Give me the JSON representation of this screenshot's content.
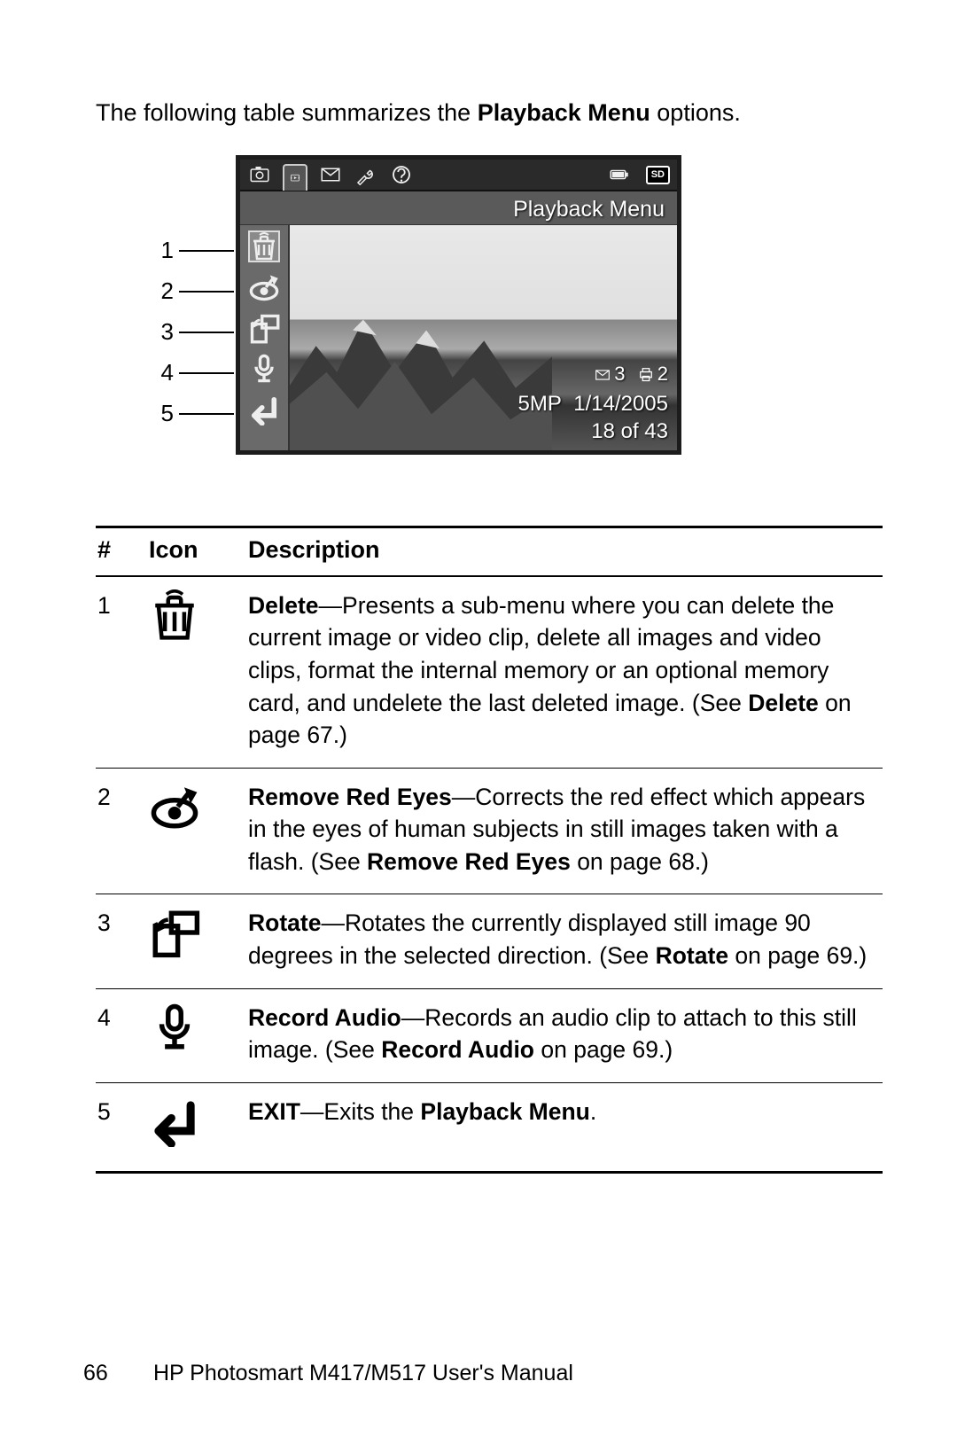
{
  "intro": {
    "before": "The following table summarizes the ",
    "bold": "Playback Menu",
    "after": " options."
  },
  "figure": {
    "lcd_title": "Playback Menu",
    "callouts": [
      "1",
      "2",
      "3",
      "4",
      "5"
    ],
    "overlay": {
      "mail_count": "3",
      "print_count": "2",
      "res": "5MP",
      "date": "1/14/2005",
      "counter": "18 of 43"
    },
    "sd_label": "SD"
  },
  "table": {
    "headers": {
      "num": "#",
      "icon": "Icon",
      "desc": "Description"
    },
    "rows": [
      {
        "num": "1",
        "icon": "trash",
        "parts": [
          {
            "b": "Delete"
          },
          {
            "t": "—Presents a sub-menu where you can delete the current image or video clip, delete all images and video clips, format the internal memory or an optional memory card, and undelete the last deleted image. (See "
          },
          {
            "b": "Delete"
          },
          {
            "t": " on page 67.)"
          }
        ]
      },
      {
        "num": "2",
        "icon": "redeye",
        "parts": [
          {
            "b": "Remove Red Eyes"
          },
          {
            "t": "—Corrects the red effect which appears in the eyes of human subjects in still images taken with a flash. (See "
          },
          {
            "b": "Remove Red Eyes"
          },
          {
            "t": " on page 68.)"
          }
        ]
      },
      {
        "num": "3",
        "icon": "rotate",
        "parts": [
          {
            "b": "Rotate"
          },
          {
            "t": "—Rotates the currently displayed still image 90 degrees in the selected direction. (See "
          },
          {
            "b": "Rotate"
          },
          {
            "t": " on page 69.)"
          }
        ]
      },
      {
        "num": "4",
        "icon": "mic",
        "parts": [
          {
            "b": "Record Audio"
          },
          {
            "t": "—Records an audio clip to attach to this still image. (See "
          },
          {
            "b": "Record Audio"
          },
          {
            "t": " on page 69.)"
          }
        ]
      },
      {
        "num": "5",
        "icon": "exit",
        "parts": [
          {
            "b": "EXIT"
          },
          {
            "t": "—Exits the "
          },
          {
            "b": "Playback Menu"
          },
          {
            "t": "."
          }
        ]
      }
    ]
  },
  "footer": {
    "page": "66",
    "title": "HP Photosmart M417/M517 User's Manual"
  }
}
